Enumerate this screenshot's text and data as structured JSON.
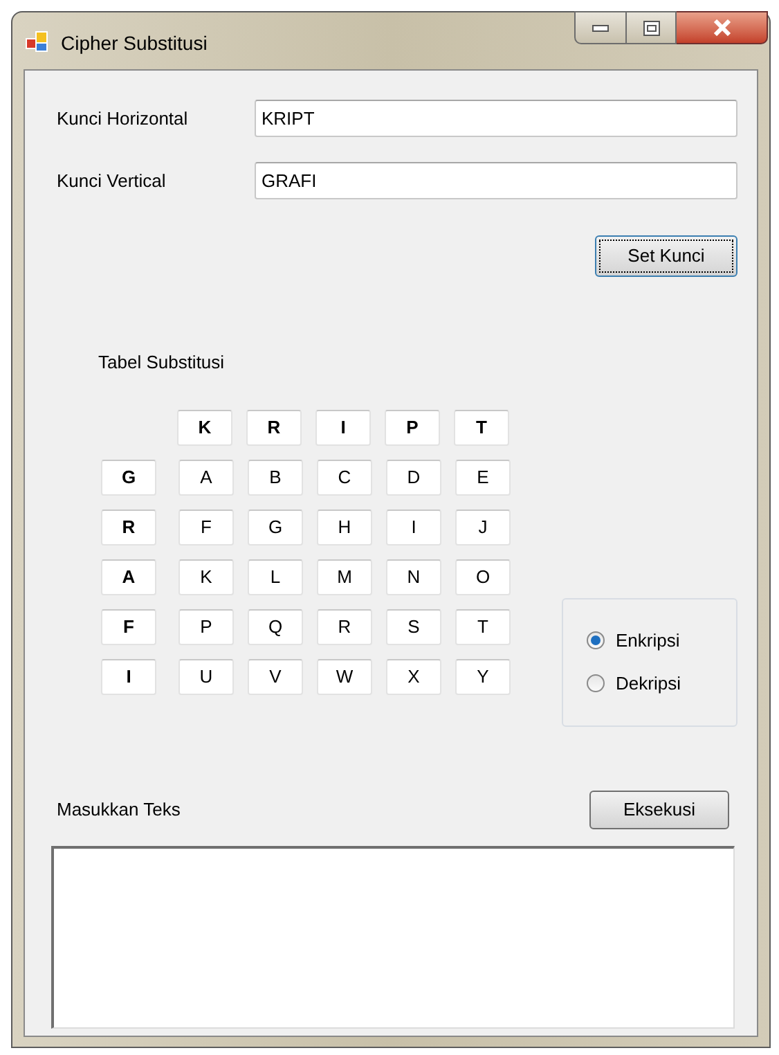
{
  "window": {
    "title": "Cipher Substitusi"
  },
  "keys": [
    {
      "label": "Kunci Horizontal",
      "value": "KRIPT"
    },
    {
      "label": "Kunci Vertical",
      "value": "GRAFI"
    }
  ],
  "set_button": "Set Kunci",
  "table": {
    "title": "Tabel Substitusi",
    "column_headers": [
      "K",
      "R",
      "I",
      "P",
      "T"
    ],
    "rows": [
      {
        "key": "G",
        "cells": [
          "A",
          "B",
          "C",
          "D",
          "E"
        ]
      },
      {
        "key": "R",
        "cells": [
          "F",
          "G",
          "H",
          "I",
          "J"
        ]
      },
      {
        "key": "A",
        "cells": [
          "K",
          "L",
          "M",
          "N",
          "O"
        ]
      },
      {
        "key": "F",
        "cells": [
          "P",
          "Q",
          "R",
          "S",
          "T"
        ]
      },
      {
        "key": "I",
        "cells": [
          "U",
          "V",
          "W",
          "X",
          "Y"
        ]
      }
    ]
  },
  "modes": [
    {
      "label": "Enkripsi",
      "selected": true
    },
    {
      "label": "Dekripsi",
      "selected": false
    }
  ],
  "text_label": "Masukkan Teks",
  "execute_button": "Eksekusi"
}
